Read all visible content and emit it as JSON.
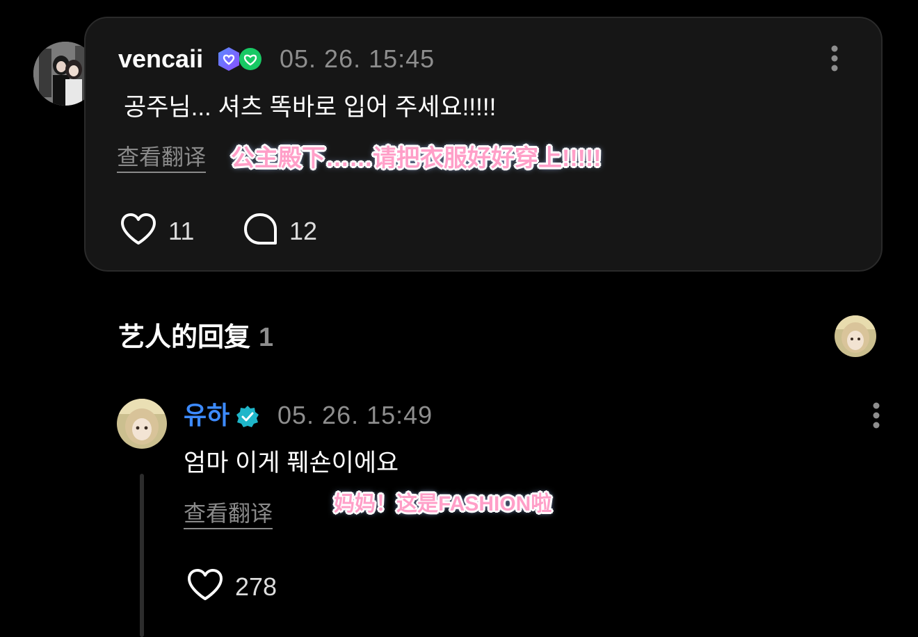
{
  "comment": {
    "username": "vencaii",
    "timestamp": "05. 26. 15:45",
    "text": "공주님... 셔츠 똑바로 입어 주세요!!!!!",
    "translate_label": "查看翻译",
    "sticker_translation": "公主殿下……请把衣服好好穿上!!!!!",
    "likes": "11",
    "replies": "12",
    "icons": [
      "avatar",
      "membership-badge-icon",
      "verified-badge-icon",
      "more-icon",
      "heart-icon",
      "comment-icon"
    ]
  },
  "artist_replies": {
    "title": "艺人的回复",
    "count": "1"
  },
  "reply": {
    "username": "유하",
    "timestamp": "05. 26. 15:49",
    "text": "엄마 이게 풰숀이에요",
    "translate_label": "查看翻译",
    "sticker_translation": "妈妈！这是FASHION啦",
    "likes": "278"
  },
  "colors": {
    "background": "#000000",
    "card": "#161616",
    "link_blue": "#3d8bff",
    "sticker_pink": "#ff9fc8",
    "badge_purple": "#6e5bff",
    "badge_green": "#18c964"
  }
}
